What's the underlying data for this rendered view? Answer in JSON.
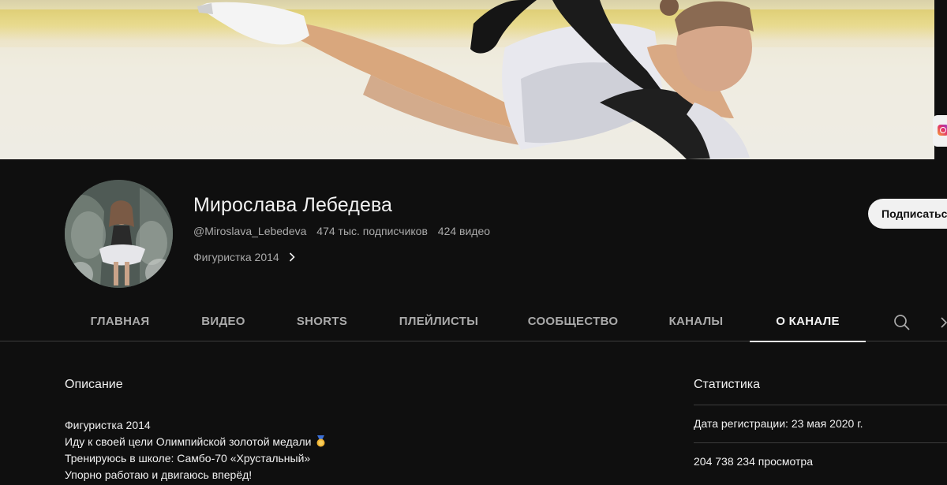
{
  "channel": {
    "name": "Мирослава Лебедева",
    "handle": "@Miroslava_Lebedeva",
    "subscribers": "474 тыс. подписчиков",
    "videos": "424 видео",
    "tagline": "Фигуристка 2014",
    "subscribe_label": "Подписаться"
  },
  "tabs": [
    {
      "label": "ГЛАВНАЯ",
      "active": false
    },
    {
      "label": "ВИДЕО",
      "active": false
    },
    {
      "label": "SHORTS",
      "active": false
    },
    {
      "label": "ПЛЕЙЛИСТЫ",
      "active": false
    },
    {
      "label": "СООБЩЕСТВО",
      "active": false
    },
    {
      "label": "КАНАЛЫ",
      "active": false
    },
    {
      "label": "О КАНАЛЕ",
      "active": true
    }
  ],
  "about": {
    "description_title": "Описание",
    "description_lines": [
      "Фигуристка 2014",
      "Иду к своей цели Олимпийской золотой медали",
      "Тренируюсь в школе: Самбо-70 «Хрустальный»",
      "Упорно работаю и двигаюсь вперёд!"
    ],
    "stats_title": "Статистика",
    "stats": {
      "joined": "Дата регистрации: 23 мая 2020 г.",
      "views": "204 738 234 просмотра"
    }
  },
  "icons": {
    "tagline_chevron": "chevron-right-icon",
    "tab_search": "search-icon",
    "tab_next": "chevron-right-icon",
    "medal": "gold-medal-icon",
    "external_link": "instagram-icon"
  },
  "colors": {
    "background": "#0f0f0f",
    "text_primary": "#f1f1f1",
    "text_secondary": "#aaaaaa",
    "divider": "#3d3d3d",
    "subscribe_bg": "#f1f1f1"
  }
}
